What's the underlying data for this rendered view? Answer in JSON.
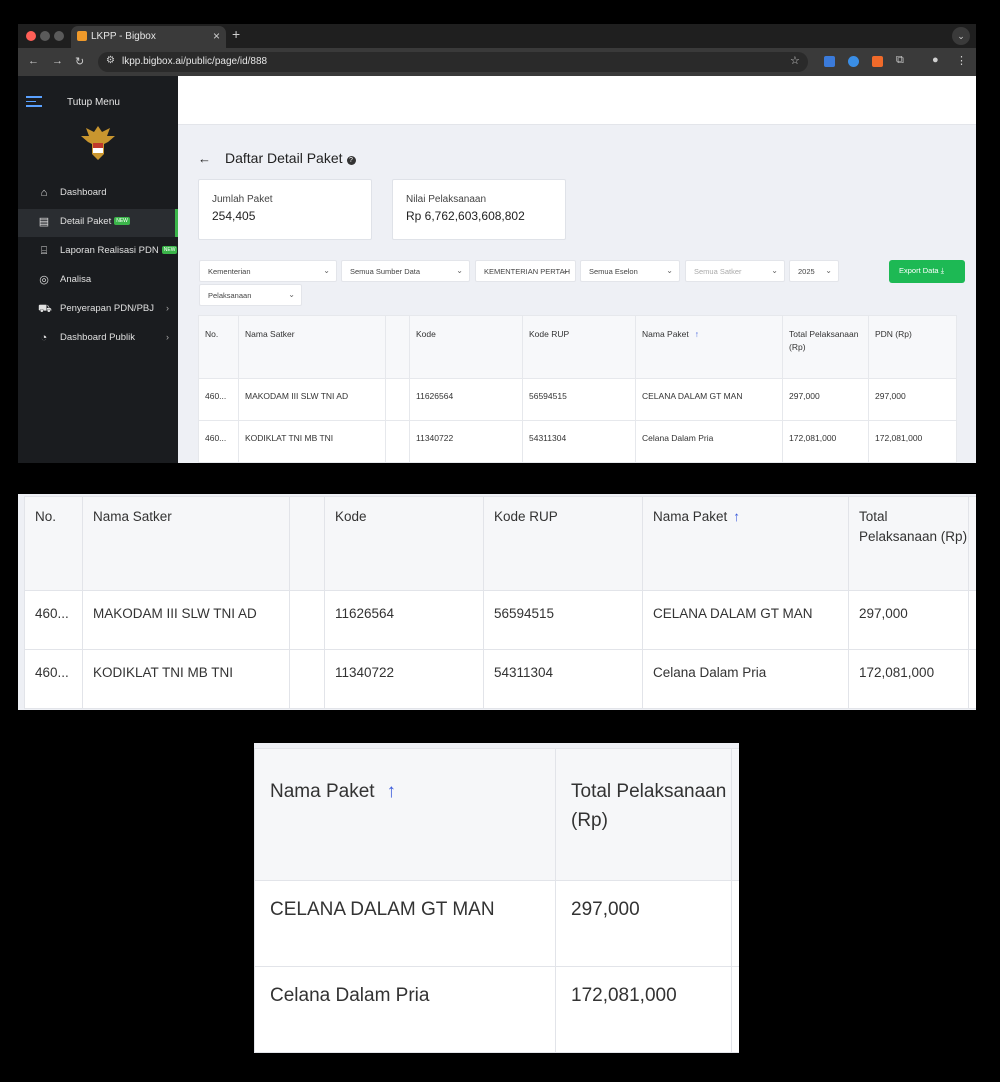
{
  "browser": {
    "tab_title": "LKPP - Bigbox",
    "tab_close": "×",
    "new_tab": "+",
    "url": "lkpp.bigbox.ai/public/page/id/888"
  },
  "sidebar": {
    "toggle_label": "Tutup Menu",
    "items": [
      {
        "label": "Dashboard",
        "icon": "home-icon"
      },
      {
        "label": "Detail Paket",
        "icon": "document-icon",
        "badge": "NEW"
      },
      {
        "label": "Laporan Realisasi PDN",
        "icon": "bank-icon",
        "badge": "NEW"
      },
      {
        "label": "Analisa",
        "icon": "analysis-icon"
      },
      {
        "label": "Penyerapan PDN/PBJ",
        "icon": "basket-icon"
      },
      {
        "label": "Dashboard Publik",
        "icon": "pie-icon"
      }
    ]
  },
  "page": {
    "title": "Daftar Detail Paket",
    "cards": [
      {
        "label": "Jumlah Paket",
        "value": "254,405"
      },
      {
        "label": "Nilai Pelaksanaan",
        "value": "Rp 6,762,603,608,802"
      }
    ],
    "filters": {
      "kementerian": "Kementerian",
      "sumber_data": "Semua Sumber Data",
      "instansi": "KEMENTERIAN PERTAH",
      "eselon": "Semua Eselon",
      "satker": "Semua Satker",
      "tahun": "2025",
      "status": "Pelaksanaan"
    },
    "export_label": "Export Data"
  },
  "table": {
    "headers": {
      "no": "No.",
      "nama_satker": "Nama Satker",
      "kode": "Kode",
      "kode_rup": "Kode RUP",
      "nama_paket": "Nama Paket",
      "total_pelaksanaan": "Total Pelaksanaan (Rp)",
      "pdn": "PDN (Rp)"
    },
    "rows": [
      {
        "no": "460...",
        "nama_satker": "MAKODAM III SLW TNI AD",
        "kode": "11626564",
        "kode_rup": "56594515",
        "nama_paket": "CELANA DALAM GT MAN",
        "total": "297,000",
        "pdn": "297,000"
      },
      {
        "no": "460...",
        "nama_satker": "KODIKLAT TNI MB TNI",
        "kode": "11340722",
        "kode_rup": "54311304",
        "nama_paket": "Celana Dalam Pria",
        "total": "172,081,000",
        "pdn": "172,081,000"
      }
    ]
  }
}
